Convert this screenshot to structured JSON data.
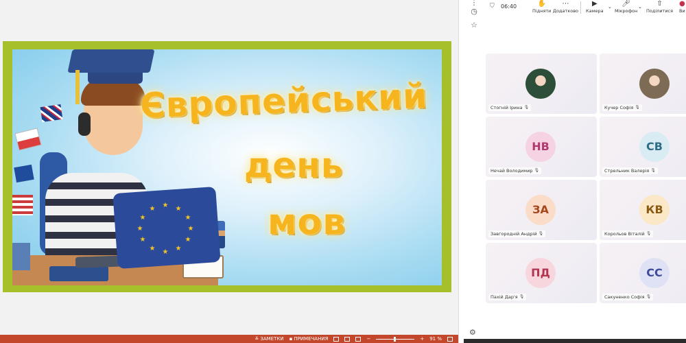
{
  "slide": {
    "title_line1": "Європейський",
    "title_line2": "день",
    "title_line3": "мов"
  },
  "status_bar": {
    "notes": "ЗАМЕТКИ",
    "comments": "ПРИМЕЧАНИЯ",
    "zoom": "91 %"
  },
  "meeting": {
    "timer": "06:40",
    "toolbar": {
      "raise": "Підняти",
      "more": "Додатково",
      "camera": "Камера",
      "mic": "Мікрофон",
      "share": "Поділитися",
      "leave": "Ви"
    },
    "participants": [
      {
        "name": "Стогній Ірина",
        "initials": "",
        "photo": true,
        "color": "#2d4f3a",
        "text_color": "#ffffff"
      },
      {
        "name": "Кучер Софія",
        "initials": "",
        "photo": true,
        "color": "#7d6b55",
        "text_color": "#ffffff"
      },
      {
        "name": "Нечай Володимир",
        "initials": "НВ",
        "photo": false,
        "color": "#f6d3e2",
        "text_color": "#b03a6d"
      },
      {
        "name": "Стрельник Валерія",
        "initials": "СВ",
        "photo": false,
        "color": "#d9ecf3",
        "text_color": "#2e6d88"
      },
      {
        "name": "Завгородній Андрій",
        "initials": "ЗА",
        "photo": false,
        "color": "#fbdcc9",
        "text_color": "#a6471c"
      },
      {
        "name": "Корольов Віталій",
        "initials": "КВ",
        "photo": false,
        "color": "#fbe8c7",
        "text_color": "#8c5a12"
      },
      {
        "name": "Пахій Дар'я",
        "initials": "ПД",
        "photo": false,
        "color": "#f8d6de",
        "text_color": "#b23550"
      },
      {
        "name": "Сакуненко Софія",
        "initials": "СС",
        "photo": false,
        "color": "#dfe2f4",
        "text_color": "#3e4a9c"
      }
    ]
  },
  "icons": {
    "shield": "shield-icon",
    "raise": "hand-icon",
    "more": "ellipsis-icon",
    "camera": "camera-icon",
    "mic": "microphone-icon",
    "share": "share-icon",
    "mic_off": "mic-off-icon",
    "settings": "gear-icon"
  }
}
